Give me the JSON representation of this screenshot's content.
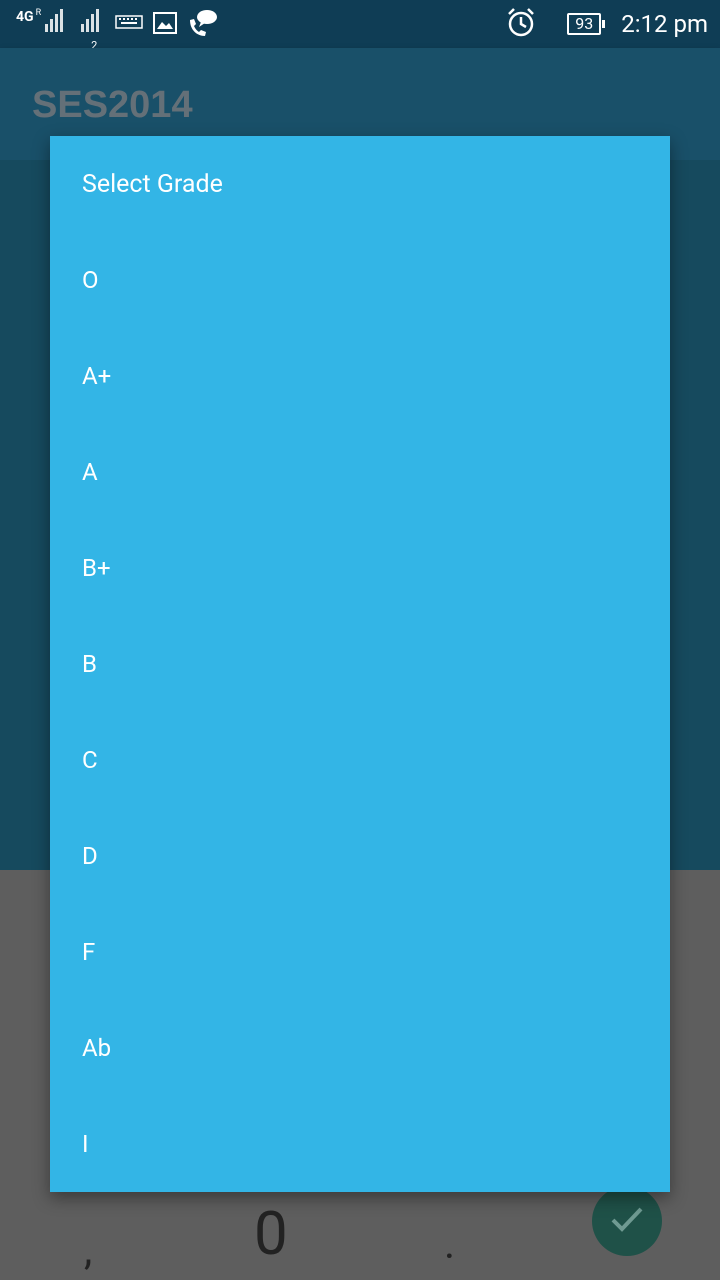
{
  "status_bar": {
    "network": "4G",
    "roaming": "R",
    "sim2_label": "2",
    "battery": "93",
    "time": "2:12 pm",
    "icons": [
      "signal-icon",
      "keyboard-icon",
      "image-icon",
      "phone-chat-icon",
      "alarm-icon",
      "battery-icon"
    ]
  },
  "app_bar": {
    "title": "SES2014"
  },
  "dialog": {
    "title": "Select Grade",
    "options": [
      "O",
      "A+",
      "A",
      "B+",
      "B",
      "C",
      "D",
      "F",
      "Ab",
      "I"
    ]
  },
  "keypad": {
    "comma": ",",
    "zero": "0",
    "dot": "."
  },
  "fab": {
    "icon": "check-icon"
  },
  "colors": {
    "status_bar": "#0f3d55",
    "app_bar": "#195069",
    "dialog": "#33b5e6",
    "fab": "#1f5148"
  }
}
